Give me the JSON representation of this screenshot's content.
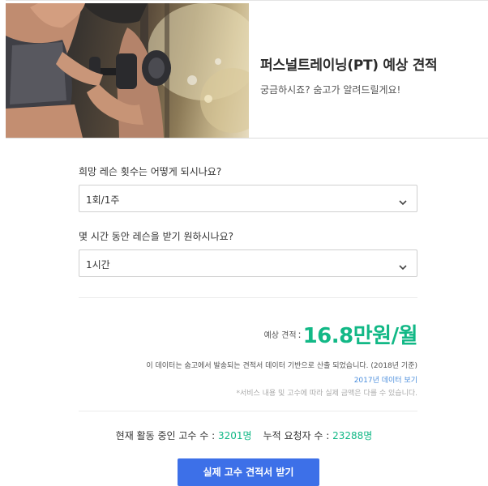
{
  "hero": {
    "title": "퍼스널트레이닝(PT) 예상 견적",
    "subtitle": "궁금하시죠? 숨고가 알려드릴게요!"
  },
  "questions": [
    {
      "label": "희망 레슨 횟수는 어떻게 되시나요?",
      "selected": "1회/1주"
    },
    {
      "label": "몇 시간 동안 레슨을 받기 원하시나요?",
      "selected": "1시간"
    }
  ],
  "estimate": {
    "label": "예상 견적",
    "colon": ":",
    "value": "16.8만원/월"
  },
  "notes": {
    "main": "이 데이터는 숨고에서 발송되는 견적서 데이터 기반으로 산출 되었습니다. (2018년 기준)",
    "link": "2017년 데이터 보기",
    "disclaimer": "*서비스 내용 및 고수에 따라 실제 금액은 다를 수 있습니다."
  },
  "stats": {
    "experts_label": "현재 활동 중인 고수 수 :",
    "experts_value": "3201명",
    "requests_label": "누적 요청자 수 :",
    "requests_value": "23288명"
  },
  "cta": {
    "label": "실제 고수 견적서 받기"
  },
  "colors": {
    "accent_green": "#12b886",
    "link_blue": "#4d8fdd",
    "button_blue": "#3d70e8"
  },
  "icons": {
    "dropdown": "chevron-down-icon"
  }
}
